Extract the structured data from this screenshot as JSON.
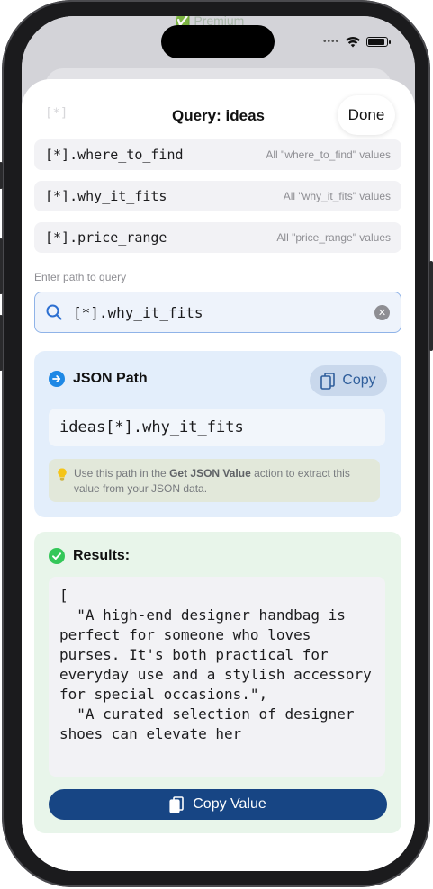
{
  "background": {
    "premium_label": "Premium"
  },
  "sheet": {
    "faded_label": "[*]",
    "title": "Query: ideas",
    "done_label": "Done"
  },
  "suggestions": [
    {
      "path": "[*].where_to_find",
      "description": "All \"where_to_find\" values"
    },
    {
      "path": "[*].why_it_fits",
      "description": "All \"why_it_fits\" values"
    },
    {
      "path": "[*].price_range",
      "description": "All \"price_range\" values"
    }
  ],
  "query": {
    "label": "Enter path to query",
    "value": "[*].why_it_fits"
  },
  "json_path": {
    "title": "JSON Path",
    "copy_label": "Copy",
    "path": "ideas[*].why_it_fits",
    "tip_prefix": "Use this path in the ",
    "tip_action": "Get JSON Value",
    "tip_suffix": " action to extract this value from your JSON data."
  },
  "results": {
    "title": "Results:",
    "text": "[\n  \"A high-end designer handbag is perfect for someone who loves purses. It's both practical for everyday use and a stylish accessory for special occasions.\",\n  \"A curated selection of designer shoes can elevate her",
    "copy_value_label": "Copy Value"
  },
  "colors": {
    "accent_blue": "#1e88e5",
    "success_green": "#34c759",
    "primary_button": "#174584"
  }
}
